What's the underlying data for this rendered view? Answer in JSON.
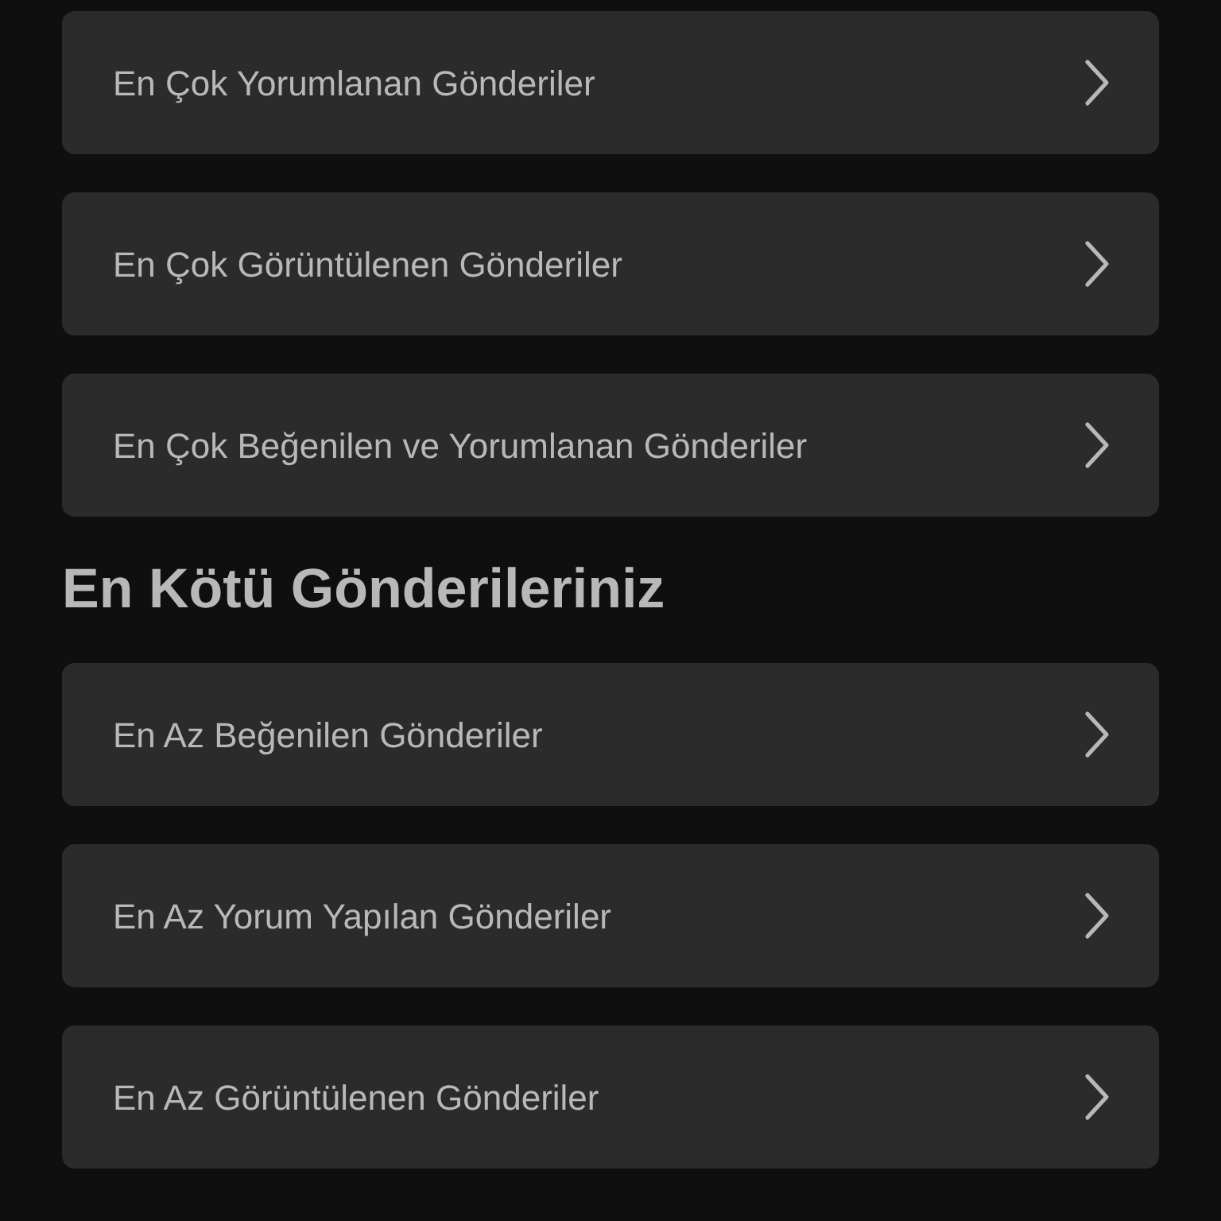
{
  "best_posts": [
    {
      "label": "En Çok Yorumlanan Gönderiler"
    },
    {
      "label": "En Çok Görüntülenen Gönderiler"
    },
    {
      "label": "En Çok Beğenilen ve Yorumlanan Gönderiler"
    }
  ],
  "worst_section": {
    "title": "En Kötü Gönderileriniz",
    "items": [
      {
        "label": "En Az Beğenilen Gönderiler"
      },
      {
        "label": "En Az Yorum Yapılan Gönderiler"
      },
      {
        "label": "En Az Görüntülenen Gönderiler"
      }
    ]
  }
}
